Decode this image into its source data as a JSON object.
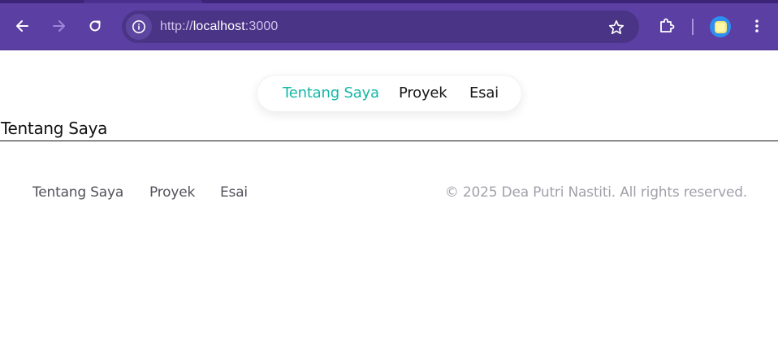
{
  "browser": {
    "url_scheme": "http://",
    "url_host": "localhost",
    "url_port": ":3000",
    "icons": {
      "back": "arrow-left-icon",
      "forward": "arrow-right-icon",
      "reload": "reload-icon",
      "site_info": "info-icon",
      "bookmark": "star-icon",
      "extensions": "puzzle-icon",
      "profile": "avatar-icon",
      "menu": "kebab-menu-icon"
    },
    "colors": {
      "toolbar": "#5b3fa3",
      "omnibox": "#4a3485"
    }
  },
  "nav": {
    "items": [
      {
        "label": "Tentang Saya",
        "active": true
      },
      {
        "label": "Proyek",
        "active": false
      },
      {
        "label": "Esai",
        "active": false
      }
    ],
    "active_color": "#14b8a6"
  },
  "main": {
    "heading": "Tentang Saya"
  },
  "footer": {
    "links": [
      {
        "label": "Tentang Saya"
      },
      {
        "label": "Proyek"
      },
      {
        "label": "Esai"
      }
    ],
    "copyright": "© 2025 Dea Putri Nastiti. All rights reserved."
  }
}
